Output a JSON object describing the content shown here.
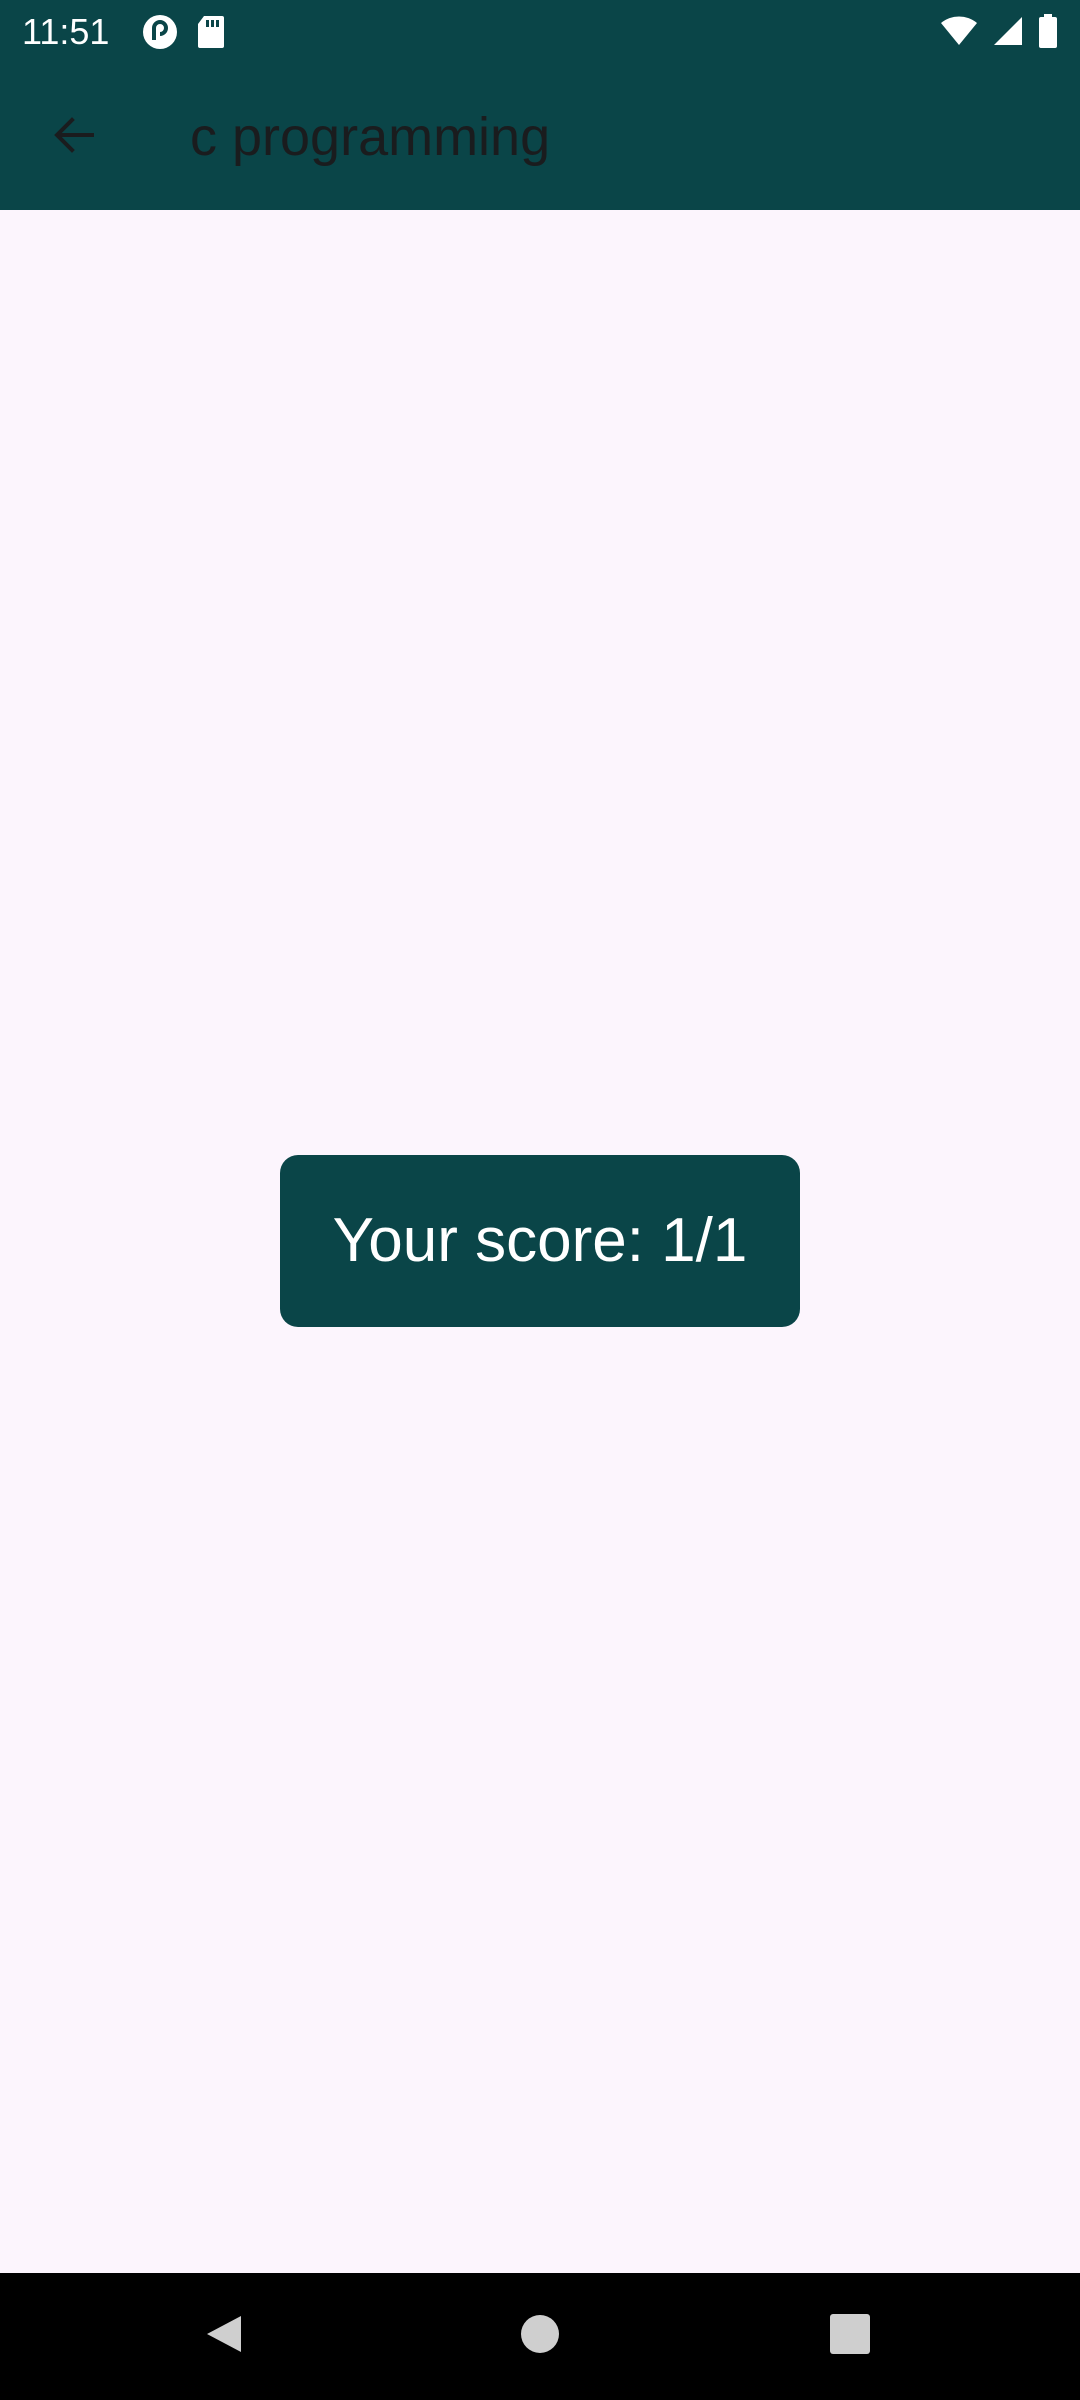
{
  "status_bar": {
    "time": "11:51",
    "icons": [
      "pocket-casts-icon",
      "sd-card-icon",
      "wifi-icon",
      "cell-signal-icon",
      "battery-icon"
    ]
  },
  "app_bar": {
    "title": "c programming",
    "back_icon": "arrow-left-icon"
  },
  "main": {
    "score_label": "Your score: 1/1"
  },
  "nav_bar": {
    "buttons": [
      "back-triangle-icon",
      "home-circle-icon",
      "recents-square-icon"
    ]
  },
  "colors": {
    "primary": "#0A4548",
    "background": "#FCF5FD",
    "on_primary": "#FFFFFF",
    "title_text": "#1A1C1E"
  }
}
